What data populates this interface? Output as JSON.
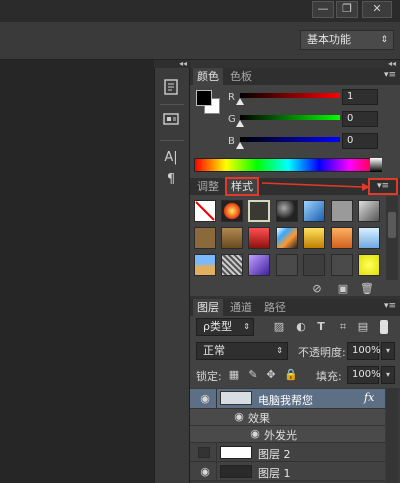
{
  "window": {
    "min_glyph": "—",
    "restore_glyph": "❐",
    "close_glyph": "✕"
  },
  "workspace": {
    "label": "基本功能"
  },
  "dock": {
    "icons": [
      "history-icon",
      "info-icon",
      "character-icon",
      "paragraph-icon"
    ],
    "glyphs": {
      "character": "A|",
      "paragraph": "¶"
    }
  },
  "collapse_glyph": "◂◂",
  "color_panel": {
    "tabs": [
      "颜色",
      "色板"
    ],
    "channels": [
      {
        "label": "R",
        "value": "1"
      },
      {
        "label": "G",
        "value": "0"
      },
      {
        "label": "B",
        "value": "0"
      }
    ],
    "colors": {
      "foreground": "#010000",
      "background": "#ffffff"
    }
  },
  "styles_panel": {
    "tabs": [
      "调整",
      "样式"
    ],
    "menu_glyph": "▾≡"
  },
  "layers_panel": {
    "tabs": [
      "图层",
      "通道",
      "路径"
    ],
    "filter_kind": "ρ类型",
    "blend_mode": "正常",
    "opacity_label": "不透明度:",
    "opacity_value": "100%",
    "lock_label": "锁定:",
    "fill_label": "填充:",
    "fill_value": "100%",
    "layers": [
      {
        "name": "电脑我帮您",
        "fx": "fx",
        "visible": true
      },
      {
        "name": "效果",
        "visible": true,
        "sub": true
      },
      {
        "name": "外发光",
        "visible": true,
        "subsub": true
      },
      {
        "name": "图层 2",
        "visible": false
      },
      {
        "name": "图层 1",
        "visible": true
      }
    ]
  },
  "accent": "#e23a2a"
}
